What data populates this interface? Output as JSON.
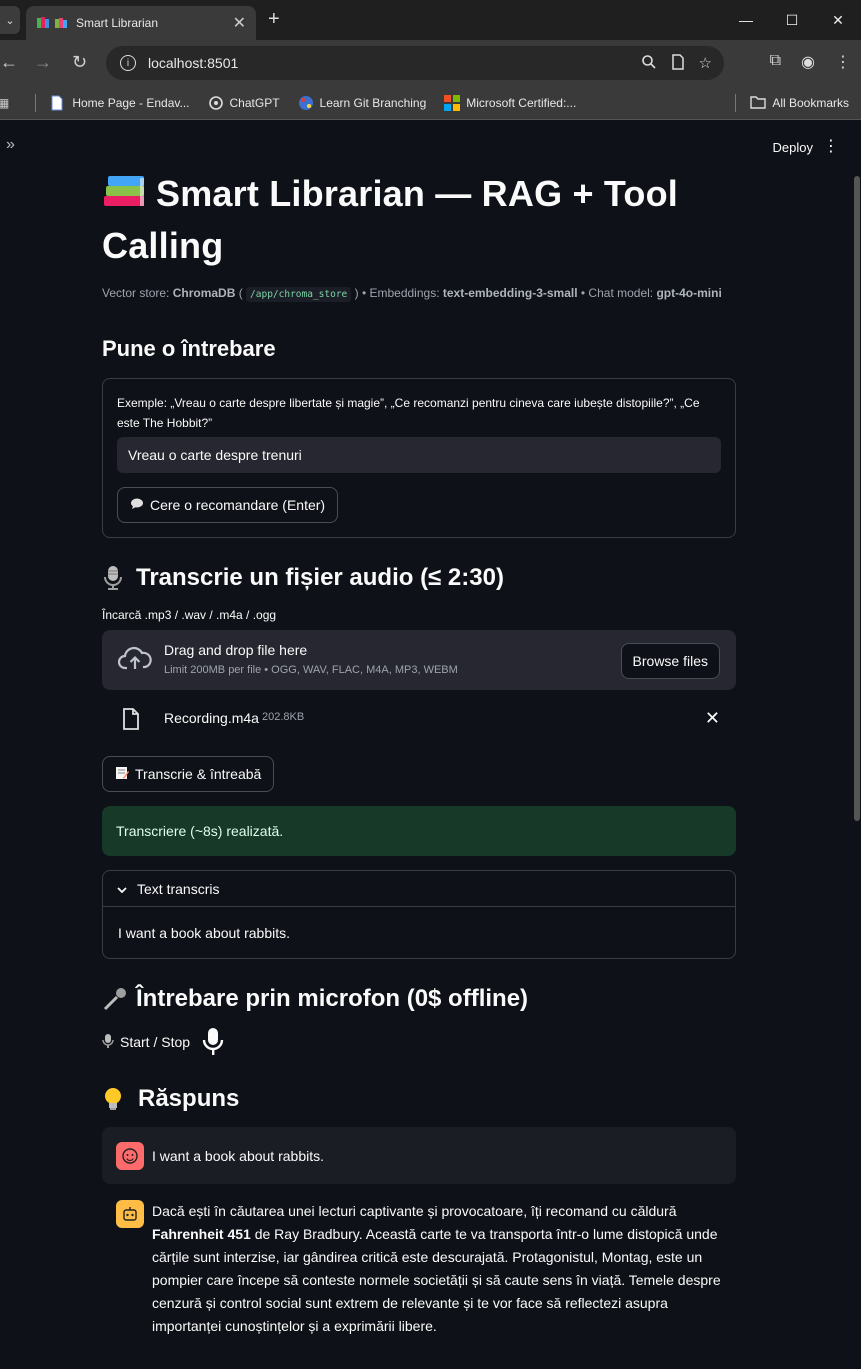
{
  "browser": {
    "tab_title": "Smart Librarian",
    "url": "localhost:8501",
    "bookmarks": [
      {
        "label": "Home Page - Endav..."
      },
      {
        "label": "ChatGPT"
      },
      {
        "label": "Learn Git Branching"
      },
      {
        "label": "Microsoft Certified:..."
      }
    ],
    "all_bookmarks": "All Bookmarks"
  },
  "app": {
    "deploy_label": "Deploy",
    "title_line1": "Smart Librarian — RAG + Tool",
    "title_line2": "Calling",
    "caption": {
      "vs_prefix": "Vector store: ",
      "vs_name": "ChromaDB",
      "vs_path": "/app/chroma_store",
      "emb_prefix": " ) • Embeddings: ",
      "emb_model": "text-embedding-3-small",
      "chat_prefix": " • Chat model: ",
      "chat_model": "gpt-4o-mini"
    },
    "ask_heading": "Pune o întrebare",
    "example_text": "Exemple: „Vreau o carte despre libertate și magie”, „Ce recomanzi pentru cineva care iubește distopiile?”, „Ce este The Hobbit?”",
    "question_value": "Vreau o carte despre trenuri",
    "recommend_button": "Cere o recomandare (Enter)",
    "transcribe_heading": "Transcrie un fișier audio (≤ 2:30)",
    "upload_label": "Încarcă .mp3 / .wav / .m4a / .ogg",
    "dropzone_title": "Drag and drop file here",
    "dropzone_limit": "Limit 200MB per file • OGG, WAV, FLAC, M4A, MP3, WEBM",
    "browse_button": "Browse files",
    "file_name": "Recording.m4a",
    "file_size": "202.8KB",
    "transcribe_button": "Transcrie & întreabă",
    "success_text": "Transcriere (~8s) realizată.",
    "expander_title": "Text transcris",
    "expander_body": "I want a book about rabbits.",
    "mic_heading": "Întrebare prin microfon (0$ offline)",
    "mic_label": "Start / Stop",
    "answer_heading": "Răspuns",
    "user_message": "I want a book about rabbits.",
    "bot_message": {
      "before": "Dacă ești în căutarea unei lecturi captivante și provocatoare, îți recomand cu căldură ",
      "bold": "Fahrenheit 451",
      "after": " de Ray Bradbury. Această carte te va transporta într-o lume distopică unde cărțile sunt interzise, iar gândirea critică este descurajată. Protagonistul, Montag, este un pompier care începe să conteste normele societății și să caute sens în viață. Temele despre cenzură și control social sunt extrem de relevante și te vor face să reflectezi asupra importanței cunoștințelor și a exprimării libere."
    }
  }
}
